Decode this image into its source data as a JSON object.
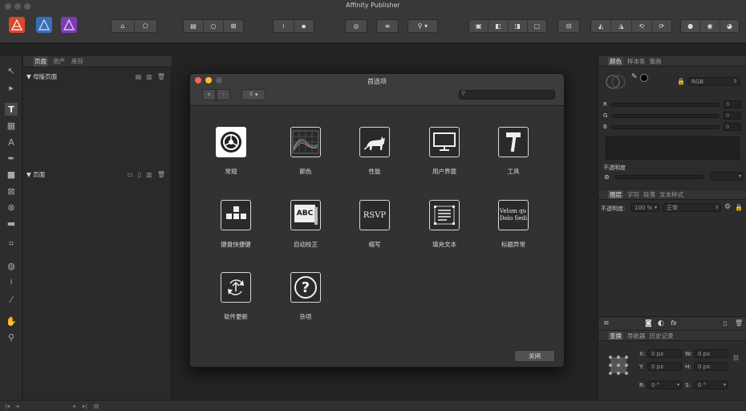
{
  "app_title": "Affinity Publisher",
  "traffic_colors": {
    "close": "#ff5f57",
    "minimize": "#febc2e",
    "zoom": "#28c840",
    "inactive": "#5a5a5a"
  },
  "personas": [
    {
      "name": "publisher-persona-icon",
      "color": "#d9482b"
    },
    {
      "name": "photo-persona-icon",
      "color": "#3a6fb5"
    },
    {
      "name": "designer-persona-icon",
      "color": "#7d3db0"
    }
  ],
  "left_panel": {
    "tabs": [
      "页面",
      "资产",
      "库存"
    ],
    "master_pages_label": "母版页面",
    "pages_label": "页面"
  },
  "dialog": {
    "title": "首选项",
    "search_placeholder": "",
    "back_symbol": "‹",
    "forward_symbol": "›",
    "close_button": "关闭",
    "items": [
      {
        "label": "常规",
        "icon": "gear-icon"
      },
      {
        "label": "颜色",
        "icon": "color-waves-icon"
      },
      {
        "label": "性能",
        "icon": "cat-icon"
      },
      {
        "label": "用户界面",
        "icon": "monitor-icon"
      },
      {
        "label": "工具",
        "icon": "hammer-icon"
      },
      {
        "label": "键盘快捷键",
        "icon": "keyboard-icon"
      },
      {
        "label": "自动校正",
        "icon": "abc-book-icon"
      },
      {
        "label": "缩写",
        "icon": "rsvp-icon"
      },
      {
        "label": "填充文本",
        "icon": "filler-text-icon"
      },
      {
        "label": "标题异常",
        "icon": "lorem-ipsum-icon"
      },
      {
        "label": "软件更新",
        "icon": "update-icon"
      },
      {
        "label": "杂项",
        "icon": "question-icon"
      }
    ],
    "icon_text": {
      "abc": "ABC",
      "rsvp": "RSVP",
      "lorem_line1": "Velum qu",
      "lorem_line2": "Dolo Sedi",
      "question": "?"
    }
  },
  "color_panel": {
    "tabs": [
      "颜色",
      "样本条",
      "笔画"
    ],
    "mode": "RGB",
    "channels": [
      {
        "label": "R",
        "value": "0"
      },
      {
        "label": "G",
        "value": "0"
      },
      {
        "label": "B",
        "value": "0"
      }
    ],
    "opacity_label": "不透明度"
  },
  "layers_panel": {
    "tabs": [
      "图层",
      "字符",
      "段落",
      "文本样式"
    ],
    "opacity_label": "不透明度:",
    "opacity_value": "100 %",
    "blend_mode": "正常",
    "fx_label": "fx"
  },
  "transform_panel": {
    "tabs": [
      "变换",
      "导航器",
      "历史记录"
    ],
    "fields": [
      {
        "label": "X:",
        "value": "0 px"
      },
      {
        "label": "W:",
        "value": "0 px"
      },
      {
        "label": "Y:",
        "value": "0 px"
      },
      {
        "label": "H:",
        "value": "0 px"
      },
      {
        "label": "R:",
        "value": "0 °"
      },
      {
        "label": "S:",
        "value": "0 °"
      }
    ]
  }
}
